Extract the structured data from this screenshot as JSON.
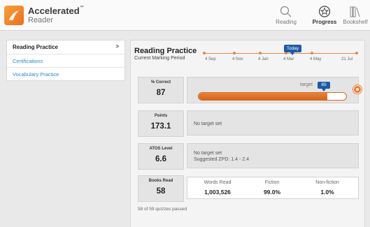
{
  "header": {
    "brand_name": "Accelerated",
    "brand_tm": "™",
    "brand_sub": "Reader",
    "nav": {
      "reading": "Reading",
      "progress": "Progress",
      "bookshelf": "Bookshelf"
    }
  },
  "sidebar": {
    "items": [
      {
        "label": "Reading Practice",
        "chevron": ">"
      },
      {
        "label": "Certifications"
      },
      {
        "label": "Vocabulary Practice"
      }
    ]
  },
  "main": {
    "title": "Reading Practice",
    "subtitle": "Current Marking Period",
    "timeline": {
      "today_label": "Today",
      "dates": [
        "4 Sep",
        "4 Nov",
        "4 Jan",
        "4 Mar",
        "4 May",
        "21 Jul"
      ]
    },
    "percent_correct": {
      "label": "% Correct",
      "value": "87",
      "progress": 0.87,
      "target_label": "target",
      "target_value": "85"
    },
    "points": {
      "label": "Points",
      "value": "173.1",
      "note": "No target set"
    },
    "atos": {
      "label": "ATOS Level",
      "value": "6.6",
      "note": "No target set",
      "zpd": "Suggested ZPD: 1.4 - 2.4"
    },
    "books": {
      "label": "Books Read",
      "value": "58",
      "columns": [
        {
          "head": "Words Read",
          "value": "1,003,526"
        },
        {
          "head": "Fiction",
          "value": "99.0%"
        },
        {
          "head": "Non-fiction",
          "value": "1.0%"
        }
      ]
    },
    "quizzes_passed": "58 of 59 quizzes passed"
  },
  "colors": {
    "accent": "#e8833c",
    "badge": "#1c5aa8",
    "link": "#2a88c8"
  }
}
